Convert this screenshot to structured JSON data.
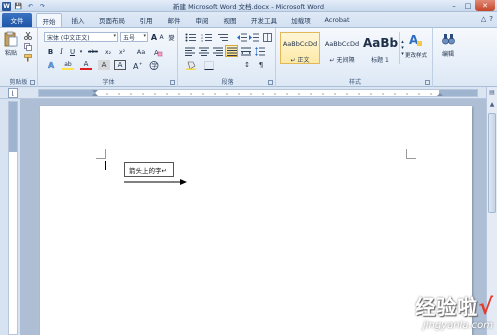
{
  "window": {
    "title": "新建 Microsoft Word 文档.docx - Microsoft Word",
    "controls": {
      "minimize": "–",
      "maximize": "□",
      "close": "✕"
    }
  },
  "qat": {
    "app_icon": "W",
    "save": "💾",
    "undo": "↶",
    "redo": "↷"
  },
  "tabs": [
    {
      "label": "文件"
    },
    {
      "label": "开始"
    },
    {
      "label": "插入"
    },
    {
      "label": "页面布局"
    },
    {
      "label": "引用"
    },
    {
      "label": "邮件"
    },
    {
      "label": "审阅"
    },
    {
      "label": "视图"
    },
    {
      "label": "开发工具"
    },
    {
      "label": "加载项"
    },
    {
      "label": "Acrobat"
    }
  ],
  "help": {
    "collapse": "△",
    "help": "?"
  },
  "ribbon": {
    "clipboard": {
      "paste_label": "粘贴",
      "group_label": "剪贴板"
    },
    "font": {
      "font_name": "宋体 (中文正文)",
      "font_size": "五号",
      "group_label": "字体",
      "grow": "A",
      "shrink": "A",
      "aa": "Aa",
      "bold": "B",
      "italic": "I",
      "underline": "U",
      "strike": "abc",
      "subscript": "x₂",
      "superscript": "x²",
      "font_color": "A",
      "highlight": "ab",
      "char_border": "A",
      "char_shade": "A",
      "phonetic": "變"
    },
    "paragraph": {
      "group_label": "段落",
      "sort": "↕",
      "show_marks": "¶"
    },
    "styles": {
      "group_label": "样式",
      "items": [
        {
          "sample": "AaBbCcDd",
          "name": "↵ 正文"
        },
        {
          "sample": "AaBbCcDd",
          "name": "↵ 无间隔"
        },
        {
          "sample": "AaBb",
          "name": "标题 1"
        }
      ],
      "change_styles": "更改样式"
    },
    "editing": {
      "label": "编辑"
    }
  },
  "document": {
    "textbox_text": "箭头上的字↵"
  },
  "watermark": {
    "text": "经验啦",
    "check": "√",
    "url": "jingyanla.com"
  }
}
